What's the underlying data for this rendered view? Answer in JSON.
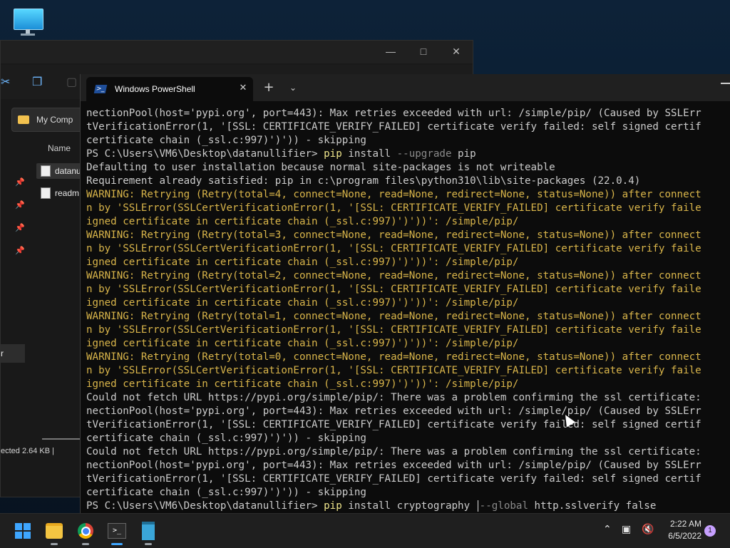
{
  "explorer": {
    "address": "My Comp",
    "column_name": "Name",
    "files": [
      "datanu",
      "readm"
    ],
    "sidebar_selected": "r",
    "status": "ected  2.64 KB  |"
  },
  "terminal": {
    "tab_title": "Windows PowerShell",
    "lines": [
      {
        "t": "nectionPool(host='pypi.org', port=443): Max retries exceeded with url: /simple/pip/ (Caused by SSLErr",
        "k": "n"
      },
      {
        "t": "tVerificationError(1, '[SSL: CERTIFICATE_VERIFY_FAILED] certificate verify failed: self signed certif",
        "k": "n"
      },
      {
        "t": "certificate chain (_ssl.c:997)')')) - skipping",
        "k": "n"
      },
      {
        "k": "cmd",
        "prompt": "PS C:\\Users\\VM6\\Desktop\\datanullifier> ",
        "cmd": "pip",
        "rest": " install ",
        "param": "--upgrade",
        "rest2": " pip"
      },
      {
        "t": "Defaulting to user installation because normal site-packages is not writeable",
        "k": "n"
      },
      {
        "t": "Requirement already satisfied: pip in c:\\program files\\python310\\lib\\site-packages (22.0.4)",
        "k": "n"
      },
      {
        "t": "WARNING: Retrying (Retry(total=4, connect=None, read=None, redirect=None, status=None)) after connect",
        "k": "w"
      },
      {
        "t": "n by 'SSLError(SSLCertVerificationError(1, '[SSL: CERTIFICATE_VERIFY_FAILED] certificate verify faile",
        "k": "w"
      },
      {
        "t": "igned certificate in certificate chain (_ssl.c:997)')'))': /simple/pip/",
        "k": "w"
      },
      {
        "t": "WARNING: Retrying (Retry(total=3, connect=None, read=None, redirect=None, status=None)) after connect",
        "k": "w"
      },
      {
        "t": "n by 'SSLError(SSLCertVerificationError(1, '[SSL: CERTIFICATE_VERIFY_FAILED] certificate verify faile",
        "k": "w"
      },
      {
        "t": "igned certificate in certificate chain (_ssl.c:997)')'))': /simple/pip/",
        "k": "w"
      },
      {
        "t": "WARNING: Retrying (Retry(total=2, connect=None, read=None, redirect=None, status=None)) after connect",
        "k": "w"
      },
      {
        "t": "n by 'SSLError(SSLCertVerificationError(1, '[SSL: CERTIFICATE_VERIFY_FAILED] certificate verify faile",
        "k": "w"
      },
      {
        "t": "igned certificate in certificate chain (_ssl.c:997)')'))': /simple/pip/",
        "k": "w"
      },
      {
        "t": "WARNING: Retrying (Retry(total=1, connect=None, read=None, redirect=None, status=None)) after connect",
        "k": "w"
      },
      {
        "t": "n by 'SSLError(SSLCertVerificationError(1, '[SSL: CERTIFICATE_VERIFY_FAILED] certificate verify faile",
        "k": "w"
      },
      {
        "t": "igned certificate in certificate chain (_ssl.c:997)')'))': /simple/pip/",
        "k": "w"
      },
      {
        "t": "WARNING: Retrying (Retry(total=0, connect=None, read=None, redirect=None, status=None)) after connect",
        "k": "w"
      },
      {
        "t": "n by 'SSLError(SSLCertVerificationError(1, '[SSL: CERTIFICATE_VERIFY_FAILED] certificate verify faile",
        "k": "w"
      },
      {
        "t": "igned certificate in certificate chain (_ssl.c:997)')'))': /simple/pip/",
        "k": "w"
      },
      {
        "t": "Could not fetch URL https://pypi.org/simple/pip/: There was a problem confirming the ssl certificate:",
        "k": "n"
      },
      {
        "t": "nectionPool(host='pypi.org', port=443): Max retries exceeded with url: /simple/pip/ (Caused by SSLErr",
        "k": "n"
      },
      {
        "t": "tVerificationError(1, '[SSL: CERTIFICATE_VERIFY_FAILED] certificate verify failed: self signed certif",
        "k": "n"
      },
      {
        "t": "certificate chain (_ssl.c:997)')')) - skipping",
        "k": "n"
      },
      {
        "t": "Could not fetch URL https://pypi.org/simple/pip/: There was a problem confirming the ssl certificate:",
        "k": "n"
      },
      {
        "t": "nectionPool(host='pypi.org', port=443): Max retries exceeded with url: /simple/pip/ (Caused by SSLErr",
        "k": "n"
      },
      {
        "t": "tVerificationError(1, '[SSL: CERTIFICATE_VERIFY_FAILED] certificate verify failed: self signed certif",
        "k": "n"
      },
      {
        "t": "certificate chain (_ssl.c:997)')')) - skipping",
        "k": "n"
      }
    ],
    "input_line": {
      "prompt": "PS C:\\Users\\VM6\\Desktop\\datanullifier> ",
      "cmd": "pip",
      "before_cursor": " install cryptography ",
      "param": "--global",
      "after": " http.sslverify false"
    }
  },
  "taskbar": {
    "time": "2:22 AM",
    "date": "6/5/2022",
    "notification_count": "1",
    "icons": [
      "windows-start-icon",
      "file-explorer-icon",
      "chrome-icon",
      "terminal-icon",
      "notepad-icon"
    ]
  },
  "colors": {
    "terminal_bg": "#0c0c0c",
    "terminal_text": "#cccccc",
    "warning_text": "#d9b54a",
    "command_text": "#f0e68c",
    "parameter_text": "#8a8a8a",
    "accent": "#3ea6ff"
  }
}
